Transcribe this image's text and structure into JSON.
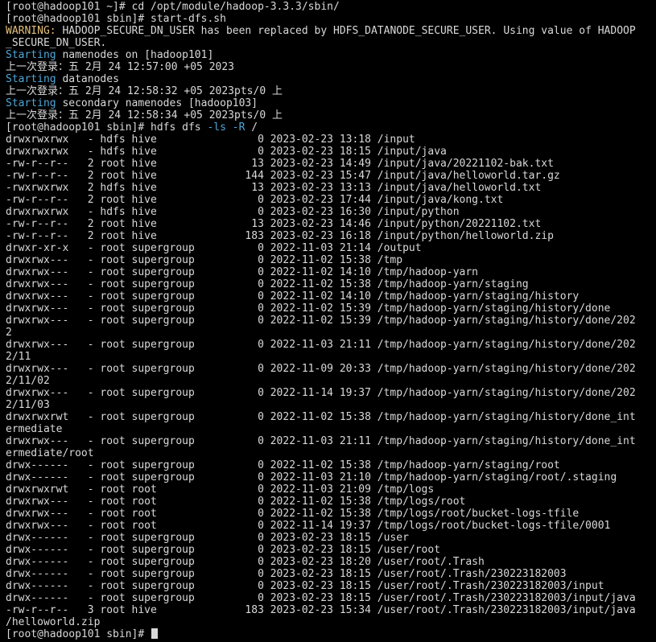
{
  "terminal": {
    "cursor_visible": true,
    "colors": {
      "background": "#000000",
      "text": "#d9d9d9",
      "warning": "#e5c07b",
      "info": "#4ea7d8"
    },
    "lines": [
      {
        "segments": [
          {
            "text": "[root@hadoop101 ~]# cd /opt/module/hadoop-3.3.3/sbin/"
          }
        ]
      },
      {
        "segments": [
          {
            "text": "[root@hadoop101 sbin]# start-dfs.sh"
          }
        ]
      },
      {
        "segments": [
          {
            "text": "WARNING:",
            "style": "warn"
          },
          {
            "text": " HADOOP_SECURE_DN_USER has been replaced by HDFS_DATANODE_SECURE_USER. Using value of HADOOP"
          }
        ]
      },
      {
        "segments": [
          {
            "text": "_SECURE_DN_USER."
          }
        ]
      },
      {
        "segments": [
          {
            "text": "Starting",
            "style": "info"
          },
          {
            "text": " namenodes on [hadoop101]"
          }
        ]
      },
      {
        "segments": [
          {
            "text": "上一次登录：五 2月 24 12:57:00 +05 2023"
          }
        ]
      },
      {
        "segments": [
          {
            "text": "Starting",
            "style": "info"
          },
          {
            "text": " datanodes"
          }
        ]
      },
      {
        "segments": [
          {
            "text": "上一次登录：五 2月 24 12:58:32 +05 2023pts/0 上"
          }
        ]
      },
      {
        "segments": [
          {
            "text": "Starting",
            "style": "info"
          },
          {
            "text": " secondary namenodes [hadoop103]"
          }
        ]
      },
      {
        "segments": [
          {
            "text": "上一次登录：五 2月 24 12:58:34 +05 2023pts/0 上"
          }
        ]
      },
      {
        "segments": [
          {
            "text": "[root@hadoop101 sbin]# hdfs dfs "
          },
          {
            "text": "-ls -R",
            "style": "flag"
          },
          {
            "text": " /"
          }
        ]
      },
      {
        "segments": [
          {
            "text": "drwxrwxrwx   - hdfs hive                0 2023-02-23 13:18 /input"
          }
        ]
      },
      {
        "segments": [
          {
            "text": "drwxrwxrwx   - hdfs hive                0 2023-02-23 18:15 /input/java"
          }
        ]
      },
      {
        "segments": [
          {
            "text": "-rw-r--r--   2 root hive               13 2023-02-23 14:49 /input/java/20221102-bak.txt"
          }
        ]
      },
      {
        "segments": [
          {
            "text": "-rw-r--r--   2 root hive              144 2023-02-23 15:47 /input/java/helloworld.tar.gz"
          }
        ]
      },
      {
        "segments": [
          {
            "text": "-rwxrwxrwx   2 hdfs hive               13 2023-02-23 13:13 /input/java/helloworld.txt"
          }
        ]
      },
      {
        "segments": [
          {
            "text": "-rw-r--r--   2 root hive                0 2023-02-23 17:44 /input/java/kong.txt"
          }
        ]
      },
      {
        "segments": [
          {
            "text": "drwxrwxrwx   - hdfs hive                0 2023-02-23 16:30 /input/python"
          }
        ]
      },
      {
        "segments": [
          {
            "text": "-rw-r--r--   2 root hive               13 2023-02-23 14:46 /input/python/20221102.txt"
          }
        ]
      },
      {
        "segments": [
          {
            "text": "-rw-r--r--   2 root hive              183 2023-02-23 16:18 /input/python/helloworld.zip"
          }
        ]
      },
      {
        "segments": [
          {
            "text": "drwxr-xr-x   - root supergroup          0 2022-11-03 21:14 /output"
          }
        ]
      },
      {
        "segments": [
          {
            "text": "drwxrwx---   - root supergroup          0 2022-11-02 15:38 /tmp"
          }
        ]
      },
      {
        "segments": [
          {
            "text": "drwxrwx---   - root supergroup          0 2022-11-02 14:10 /tmp/hadoop-yarn"
          }
        ]
      },
      {
        "segments": [
          {
            "text": "drwxrwx---   - root supergroup          0 2022-11-02 15:38 /tmp/hadoop-yarn/staging"
          }
        ]
      },
      {
        "segments": [
          {
            "text": "drwxrwx---   - root supergroup          0 2022-11-02 14:10 /tmp/hadoop-yarn/staging/history"
          }
        ]
      },
      {
        "segments": [
          {
            "text": "drwxrwx---   - root supergroup          0 2022-11-02 15:39 /tmp/hadoop-yarn/staging/history/done"
          }
        ]
      },
      {
        "segments": [
          {
            "text": "drwxrwx---   - root supergroup          0 2022-11-02 15:39 /tmp/hadoop-yarn/staging/history/done/202"
          }
        ]
      },
      {
        "segments": [
          {
            "text": "2"
          }
        ]
      },
      {
        "segments": [
          {
            "text": "drwxrwx---   - root supergroup          0 2022-11-03 21:11 /tmp/hadoop-yarn/staging/history/done/202"
          }
        ]
      },
      {
        "segments": [
          {
            "text": "2/11"
          }
        ]
      },
      {
        "segments": [
          {
            "text": "drwxrwx---   - root supergroup          0 2022-11-09 20:33 /tmp/hadoop-yarn/staging/history/done/202"
          }
        ]
      },
      {
        "segments": [
          {
            "text": "2/11/02"
          }
        ]
      },
      {
        "segments": [
          {
            "text": "drwxrwx---   - root supergroup          0 2022-11-14 19:37 /tmp/hadoop-yarn/staging/history/done/202"
          }
        ]
      },
      {
        "segments": [
          {
            "text": "2/11/03"
          }
        ]
      },
      {
        "segments": [
          {
            "text": "drwxrwxrwt   - root supergroup          0 2022-11-02 15:38 /tmp/hadoop-yarn/staging/history/done_int"
          }
        ]
      },
      {
        "segments": [
          {
            "text": "ermediate"
          }
        ]
      },
      {
        "segments": [
          {
            "text": "drwxrwx---   - root supergroup          0 2022-11-03 21:11 /tmp/hadoop-yarn/staging/history/done_int"
          }
        ]
      },
      {
        "segments": [
          {
            "text": "ermediate/root"
          }
        ]
      },
      {
        "segments": [
          {
            "text": "drwx------   - root supergroup          0 2022-11-02 15:38 /tmp/hadoop-yarn/staging/root"
          }
        ]
      },
      {
        "segments": [
          {
            "text": "drwx------   - root supergroup          0 2022-11-03 21:10 /tmp/hadoop-yarn/staging/root/.staging"
          }
        ]
      },
      {
        "segments": [
          {
            "text": "drwxrwxrwt   - root root                0 2022-11-03 21:09 /tmp/logs"
          }
        ]
      },
      {
        "segments": [
          {
            "text": "drwxrwx---   - root root                0 2022-11-02 15:38 /tmp/logs/root"
          }
        ]
      },
      {
        "segments": [
          {
            "text": "drwxrwx---   - root root                0 2022-11-02 15:38 /tmp/logs/root/bucket-logs-tfile"
          }
        ]
      },
      {
        "segments": [
          {
            "text": "drwxrwx---   - root root                0 2022-11-14 19:37 /tmp/logs/root/bucket-logs-tfile/0001"
          }
        ]
      },
      {
        "segments": [
          {
            "text": "drwx------   - root supergroup          0 2023-02-23 18:15 /user"
          }
        ]
      },
      {
        "segments": [
          {
            "text": "drwx------   - root supergroup          0 2023-02-23 18:15 /user/root"
          }
        ]
      },
      {
        "segments": [
          {
            "text": "drwx------   - root supergroup          0 2023-02-23 18:20 /user/root/.Trash"
          }
        ]
      },
      {
        "segments": [
          {
            "text": "drwx------   - root supergroup          0 2023-02-23 18:15 /user/root/.Trash/230223182003"
          }
        ]
      },
      {
        "segments": [
          {
            "text": "drwx------   - root supergroup          0 2023-02-23 18:15 /user/root/.Trash/230223182003/input"
          }
        ]
      },
      {
        "segments": [
          {
            "text": "drwx------   - root supergroup          0 2023-02-23 18:15 /user/root/.Trash/230223182003/input/java"
          }
        ]
      },
      {
        "segments": [
          {
            "text": "-rw-r--r--   3 root hive              183 2023-02-23 15:34 /user/root/.Trash/230223182003/input/java"
          }
        ]
      },
      {
        "segments": [
          {
            "text": "/helloworld.zip"
          }
        ]
      },
      {
        "segments": [
          {
            "text": "[root@hadoop101 sbin]# "
          }
        ],
        "cursor": true
      }
    ]
  }
}
